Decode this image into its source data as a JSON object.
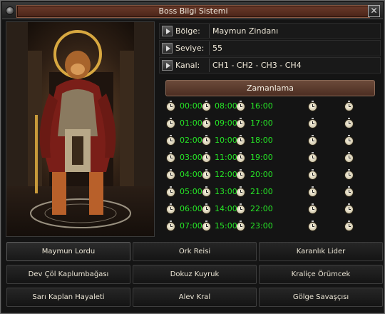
{
  "window": {
    "title": "Boss Bilgi Sistemi",
    "close_label": "✕"
  },
  "info": [
    {
      "key": "Bölge:",
      "value": "Maymun Zindanı"
    },
    {
      "key": "Seviye:",
      "value": "55"
    },
    {
      "key": "Kanal:",
      "value": "CH1 - CH2 - CH3 - CH4"
    }
  ],
  "schedule": {
    "button_label": "Zamanlama",
    "rows": [
      [
        "00:00",
        "08:00",
        "16:00"
      ],
      [
        "01:00",
        "09:00",
        "17:00"
      ],
      [
        "02:00",
        "10:00",
        "18:00"
      ],
      [
        "03:00",
        "11:00",
        "19:00"
      ],
      [
        "04:00",
        "12:00",
        "20:00"
      ],
      [
        "05:00",
        "13:00",
        "21:00"
      ],
      [
        "06:00",
        "14:00",
        "22:00"
      ],
      [
        "07:00",
        "15:00",
        "23:00"
      ]
    ],
    "time_color": "#26e626"
  },
  "bosses": [
    [
      "Maymun Lordu",
      "Ork Reisi",
      "Karanlık Lider"
    ],
    [
      "Dev Çöl Kaplumbağası",
      "Dokuz Kuyruk",
      "Kraliçe Örümcek"
    ],
    [
      "Sarı Kaplan Hayaleti",
      "Alev Kral",
      "Gölge Savaşçısı"
    ]
  ],
  "selected_boss": "Maymun Lordu",
  "icons": {
    "window": "orb-icon",
    "info_row": "play-arrow-icon",
    "schedule": "stopwatch-icon"
  },
  "colors": {
    "title_plaque": "#5a2e20",
    "schedule_button": "#5c3a2c"
  }
}
